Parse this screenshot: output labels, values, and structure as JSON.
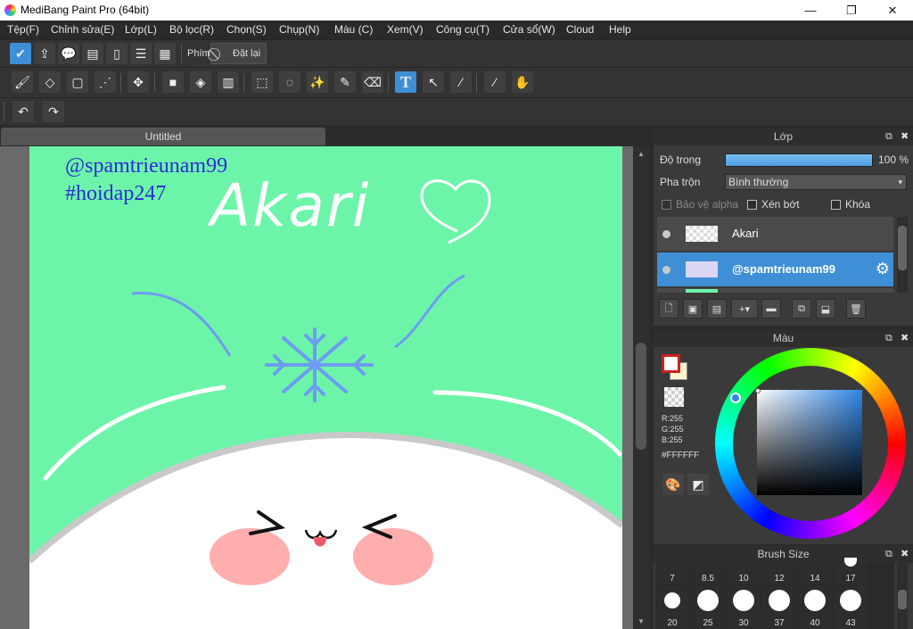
{
  "window": {
    "title": "MediBang Paint Pro (64bit)",
    "minimize_glyph": "—",
    "maximize_glyph": "❐",
    "close_glyph": "✕"
  },
  "menu": [
    "Tệp(F)",
    "Chỉnh sửa(E)",
    "Lớp(L)",
    "Bộ lọc(R)",
    "Chọn(S)",
    "Chụp(N)",
    "Màu (C)",
    "Xem(V)",
    "Công cụ(T)",
    "Cửa sổ(W)",
    "Cloud",
    "Help"
  ],
  "toolbar": {
    "shortcut_label": "Phím",
    "reset_label": "Đặt lại"
  },
  "document": {
    "tab_title": "Untitled"
  },
  "canvas": {
    "bg_color": "#6cf5a8",
    "handle_text": "@spamtrieunam99",
    "hashtag_text": "#hoidap247",
    "name_text": "Akari",
    "handle_color": "#2b2bd8"
  },
  "layer_panel": {
    "title": "Lớp",
    "opacity_label": "Độ trong",
    "opacity_value": "100 %",
    "blend_label": "Pha trộn",
    "blend_value": "Bình thường",
    "protect_alpha_label": "Bảo vệ alpha",
    "clipping_label": "Xén bớt",
    "lock_label": "Khóa",
    "layers": [
      {
        "name": "Akari",
        "selected": false
      },
      {
        "name": "@spamtrieunam99",
        "selected": true
      }
    ],
    "accent_color": "#3f8fd6"
  },
  "color_panel": {
    "title": "Màu",
    "r": "R:255",
    "g": "G:255",
    "b": "B:255",
    "hex": "#FFFFFF",
    "fg_color": "#ffffff",
    "bg_color": "#fff3cf"
  },
  "brush_panel": {
    "title": "Brush Size",
    "row1": [
      "7",
      "8.5",
      "10",
      "12",
      "14",
      "17"
    ],
    "row2": [
      "20",
      "25",
      "30",
      "37",
      "40",
      "43"
    ]
  }
}
